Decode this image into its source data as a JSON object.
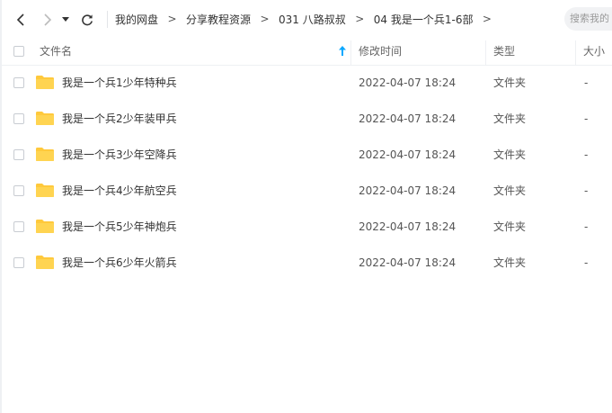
{
  "toolbar": {
    "breadcrumb": [
      "我的网盘",
      "分享教程资源",
      "031 八路叔叔",
      "04 我是一个兵1-6部"
    ],
    "separator": ">",
    "search_placeholder": "搜索我的"
  },
  "table": {
    "columns": {
      "name": "文件名",
      "modified": "修改时间",
      "type": "类型",
      "size": "大小"
    },
    "rows": [
      {
        "name": "我是一个兵1少年特种兵",
        "modified": "2022-04-07 18:24",
        "type": "文件夹",
        "size": "-"
      },
      {
        "name": "我是一个兵2少年装甲兵",
        "modified": "2022-04-07 18:24",
        "type": "文件夹",
        "size": "-"
      },
      {
        "name": "我是一个兵3少年空降兵",
        "modified": "2022-04-07 18:24",
        "type": "文件夹",
        "size": "-"
      },
      {
        "name": "我是一个兵4少年航空兵",
        "modified": "2022-04-07 18:24",
        "type": "文件夹",
        "size": "-"
      },
      {
        "name": "我是一个兵5少年神炮兵",
        "modified": "2022-04-07 18:24",
        "type": "文件夹",
        "size": "-"
      },
      {
        "name": "我是一个兵6少年火箭兵",
        "modified": "2022-04-07 18:24",
        "type": "文件夹",
        "size": "-"
      }
    ]
  },
  "colors": {
    "folder": "#ffc93c",
    "sort_arrow": "#06a7ff",
    "divider": "#eef0f3"
  }
}
